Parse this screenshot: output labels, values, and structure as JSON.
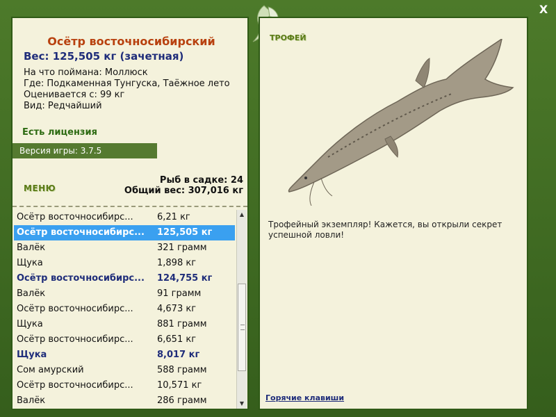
{
  "close_label": "X",
  "left": {
    "fish_name": "Осётр восточносибирский",
    "weight": "Вес: 125,505 кг (зачетная)",
    "caught_on": "На что поймана: Моллюск",
    "location": "Где: Подкаменная Тунгуска, Таёжное лето",
    "valued_from": "Оценивается с: 99 кг",
    "kind": "Вид: Редчайший",
    "license": "Есть лицензия",
    "version": "Версия игры: 3.7.5",
    "menu_label": "МЕНЮ",
    "fish_in_cage": "Рыб в садке: 24",
    "total_weight": "Общий вес: 307,016 кг"
  },
  "catch_list": [
    {
      "name": "Осётр восточносибирс...",
      "weight": "6,21 кг",
      "style": "normal"
    },
    {
      "name": "Осётр восточносибирс...",
      "weight": "125,505 кг",
      "style": "selected"
    },
    {
      "name": "Валёк",
      "weight": "321 грамм",
      "style": "normal"
    },
    {
      "name": "Щука",
      "weight": "1,898 кг",
      "style": "normal"
    },
    {
      "name": "Осётр восточносибирс...",
      "weight": "124,755 кг",
      "style": "bold"
    },
    {
      "name": "Валёк",
      "weight": "91 грамм",
      "style": "normal"
    },
    {
      "name": "Осётр восточносибирс...",
      "weight": "4,673 кг",
      "style": "normal"
    },
    {
      "name": "Щука",
      "weight": "881 грамм",
      "style": "normal"
    },
    {
      "name": "Осётр восточносибирс...",
      "weight": "6,651 кг",
      "style": "normal"
    },
    {
      "name": "Щука",
      "weight": "8,017 кг",
      "style": "bold"
    },
    {
      "name": "Сом амурский",
      "weight": "588 грамм",
      "style": "normal"
    },
    {
      "name": "Осётр восточносибирс...",
      "weight": "10,571 кг",
      "style": "normal"
    },
    {
      "name": "Валёк",
      "weight": "286 грамм",
      "style": "normal"
    }
  ],
  "right": {
    "trophy_label": "ТРОФЕЙ",
    "trophy_text": "Трофейный экземпляр! Кажется, вы открыли секрет успешной ловли!",
    "hotkeys_label": "Горячие клавиши"
  },
  "colors": {
    "frame": "#4d7a2a",
    "panel": "#f4f2dc",
    "accent_title": "#b8410f",
    "selected_row": "#3aa0f0",
    "bold_row": "#1f2d7a"
  }
}
